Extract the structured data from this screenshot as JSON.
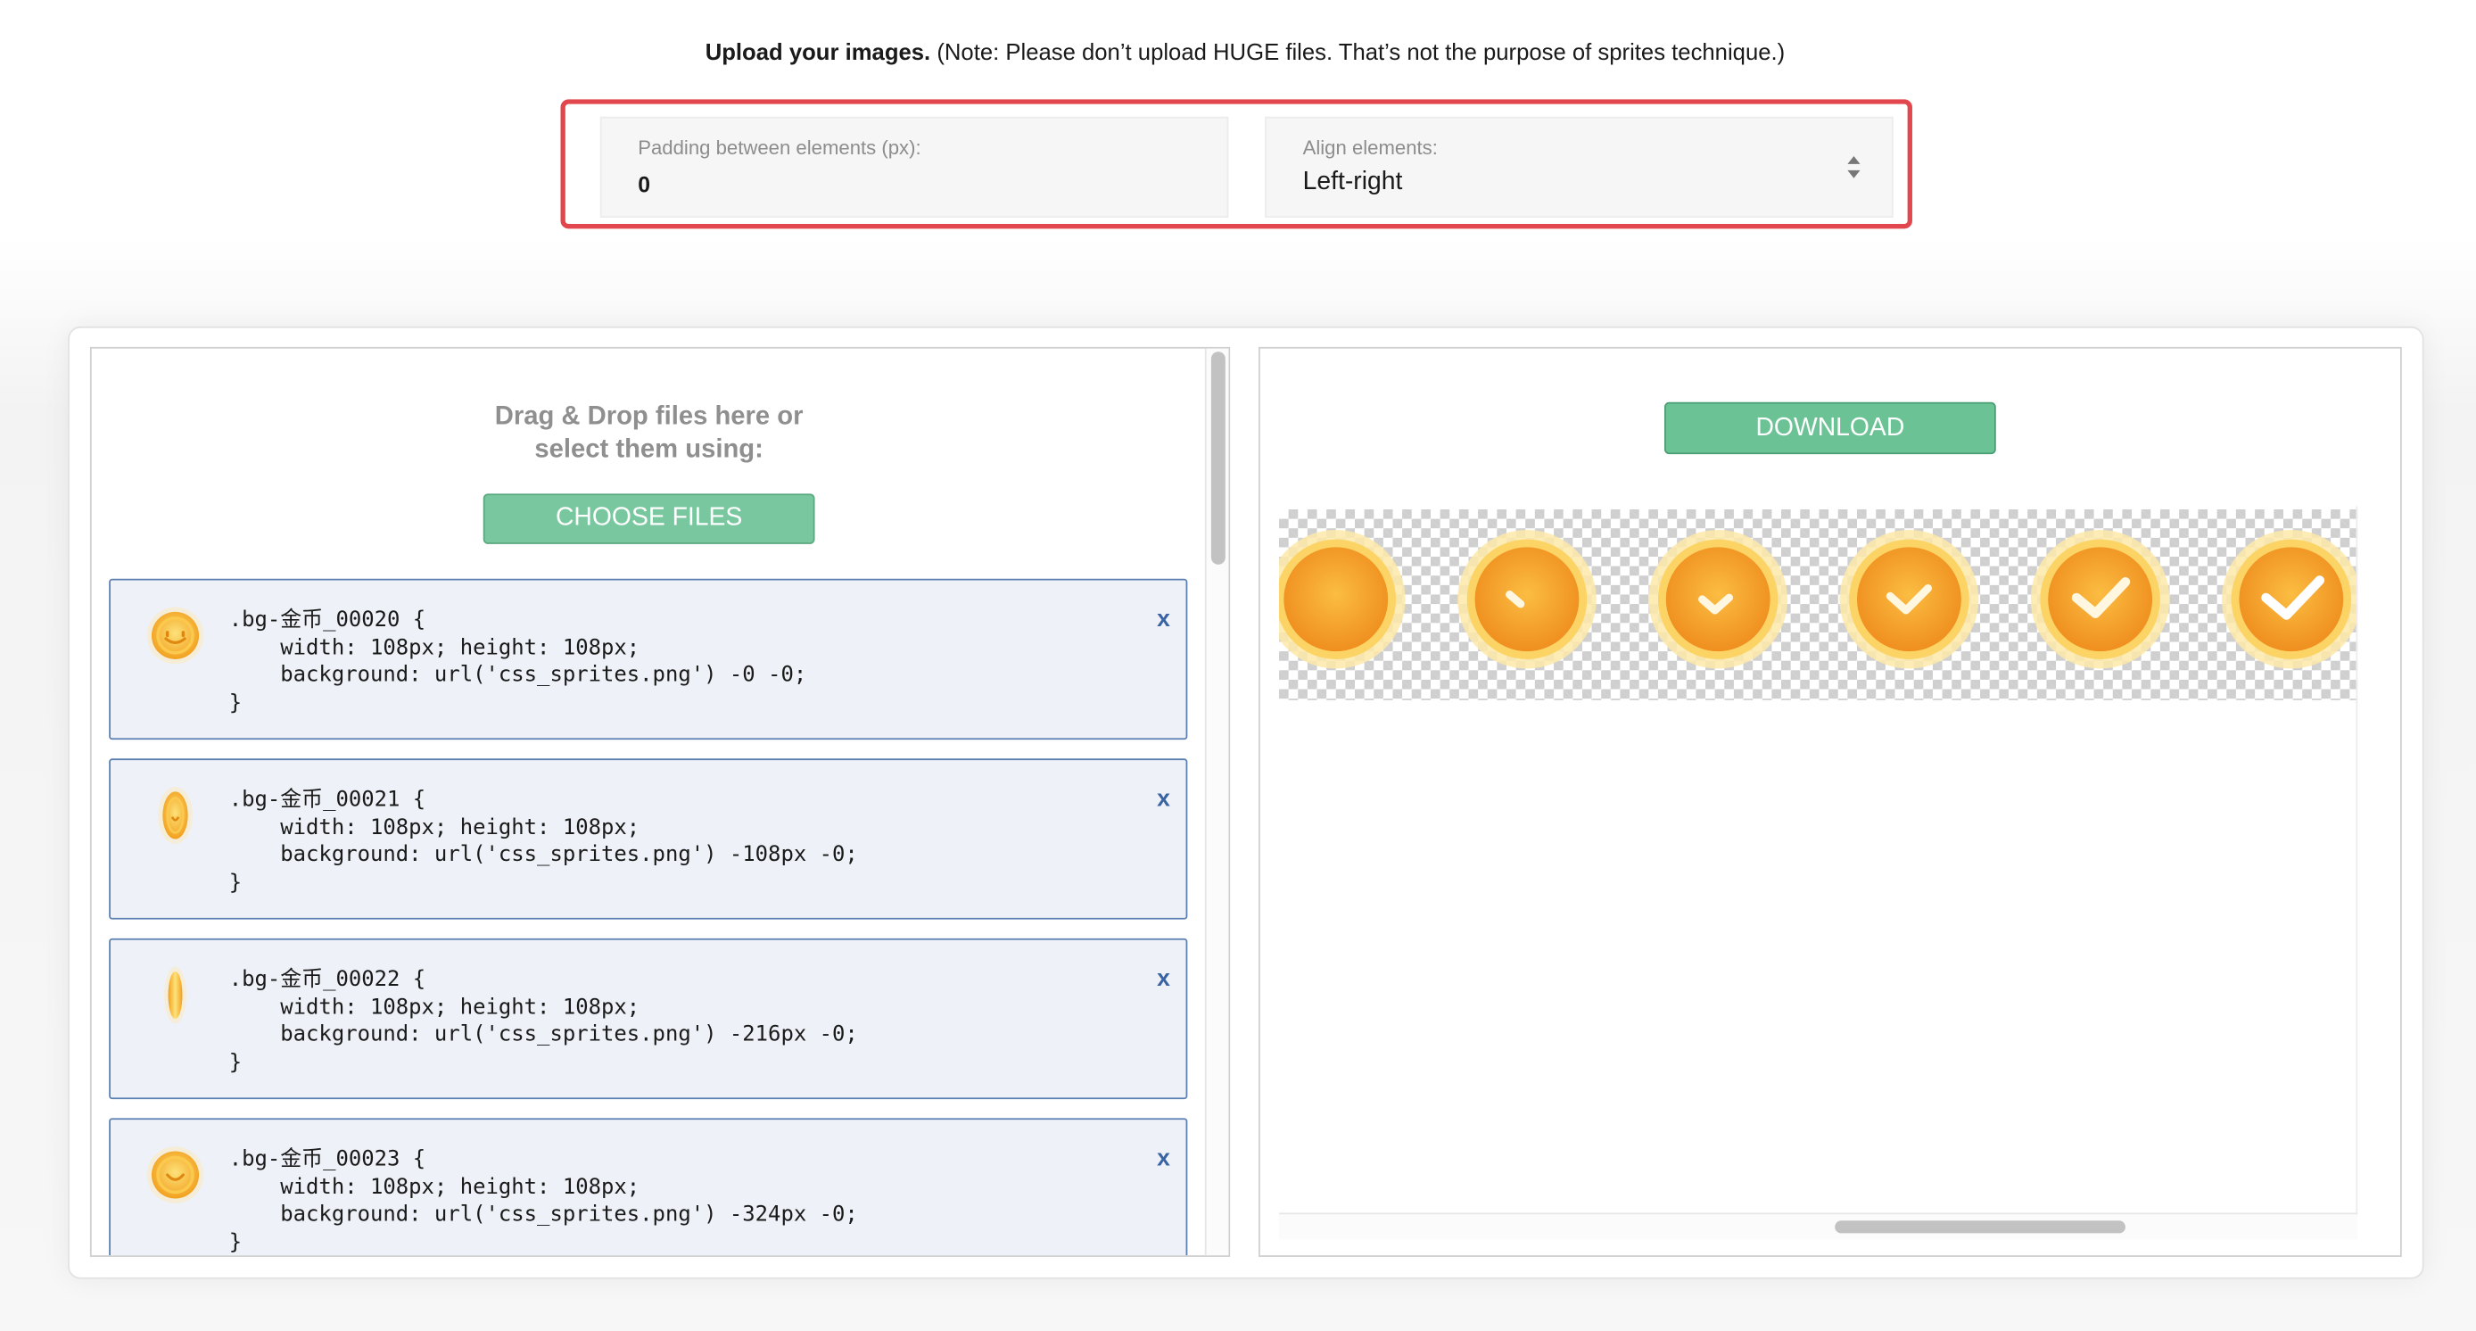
{
  "header": {
    "bold": "Upload your images.",
    "note": " (Note: Please don’t upload HUGE files. That’s not the purpose of sprites technique.)"
  },
  "options": {
    "padding": {
      "label": "Padding between elements (px):",
      "value": "0"
    },
    "align": {
      "label": "Align elements:",
      "value": "Left-right",
      "icon": "sort-arrows-icon"
    }
  },
  "upload": {
    "line1": "Drag & Drop files here or",
    "line2": "select them using:",
    "choose_label": "CHOOSE FILES"
  },
  "files": [
    {
      "selector": ".bg-金币_00020 {",
      "line1": "    width: 108px; height: 108px;",
      "line2": "    background: url('css_sprites.png') -0 -0;",
      "close": "}",
      "remove": "x",
      "thumb": "coin-front"
    },
    {
      "selector": ".bg-金币_00021 {",
      "line1": "    width: 108px; height: 108px;",
      "line2": "    background: url('css_sprites.png') -108px -0;",
      "close": "}",
      "remove": "x",
      "thumb": "coin-turn"
    },
    {
      "selector": ".bg-金币_00022 {",
      "line1": "    width: 108px; height: 108px;",
      "line2": "    background: url('css_sprites.png') -216px -0;",
      "close": "}",
      "remove": "x",
      "thumb": "coin-edge"
    },
    {
      "selector": ".bg-金币_00023 {",
      "line1": "    width: 108px; height: 108px;",
      "line2": "    background: url('css_sprites.png') -324px -0;",
      "close": "}",
      "remove": "x",
      "thumb": "coin-front"
    }
  ],
  "preview": {
    "download_label": "DOWNLOAD",
    "frames": [
      "coin-plain",
      "check-stage-1",
      "check-stage-2",
      "check-stage-3",
      "check-stage-4",
      "check-stage-5"
    ]
  },
  "colors": {
    "accent_green": "#6bc295",
    "highlight_red": "#e1474c",
    "item_border_blue": "#5a7fb2",
    "coin_orange": "#f4a22e"
  }
}
